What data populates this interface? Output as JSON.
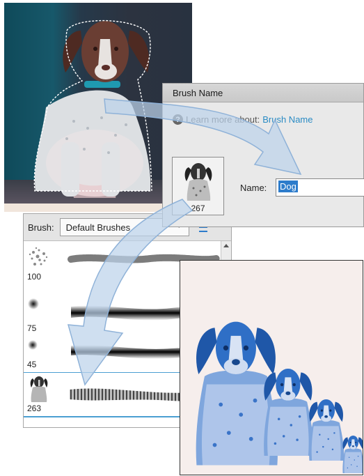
{
  "dialog": {
    "title": "Brush Name",
    "learn_prefix": "Learn more about:",
    "learn_link": "Brush Name",
    "preview_size": "267",
    "name_label": "Name:",
    "name_value": "Dog"
  },
  "brush_panel": {
    "label": "Brush:",
    "selected_set": "Default Brushes",
    "brushes": [
      {
        "size": "100"
      },
      {
        "size": "75"
      },
      {
        "size": "45"
      },
      {
        "size": "263"
      }
    ]
  },
  "colors": {
    "accent": "#2d7ccb",
    "link": "#2a8bc4",
    "stamp_blue": "#2f6fc6",
    "arrow_fill": "#bcd3ea"
  }
}
